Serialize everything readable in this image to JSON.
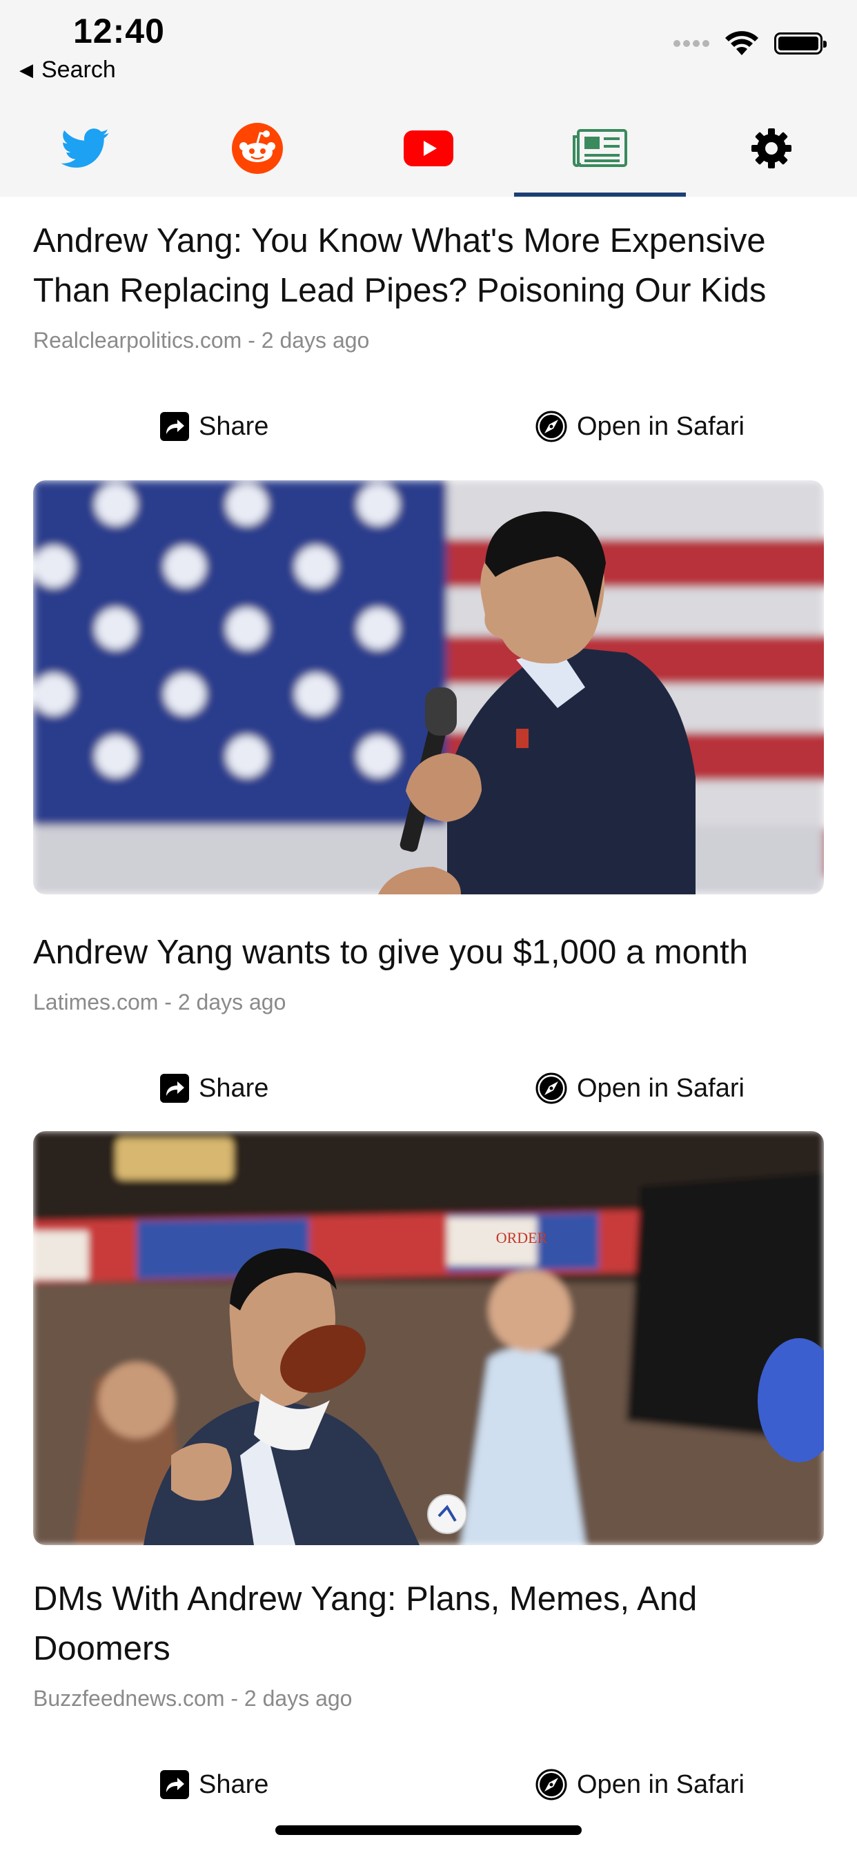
{
  "status_bar": {
    "time": "12:40",
    "back_label": "Search",
    "icons": [
      "cellular-signal-icon",
      "wifi-icon",
      "battery-icon"
    ]
  },
  "tabs": [
    {
      "name": "twitter",
      "icon": "twitter-bird-icon",
      "color": "#1da1f2",
      "active": false
    },
    {
      "name": "reddit",
      "icon": "reddit-alien-icon",
      "color": "#ff4500",
      "active": false
    },
    {
      "name": "youtube",
      "icon": "youtube-play-icon",
      "color": "#ff0000",
      "active": false
    },
    {
      "name": "news",
      "icon": "newspaper-icon",
      "color": "#3a8a5e",
      "active": true
    },
    {
      "name": "settings",
      "icon": "gear-icon",
      "color": "#000000",
      "active": false
    }
  ],
  "active_indicator_color": "#1c3f74",
  "articles": [
    {
      "title": "Andrew Yang: You Know What's More Expensive Than Replacing Lead Pipes? Poisoning Our Kids",
      "meta": "Realclearpolitics.com - 2 days ago",
      "share_label": "Share",
      "safari_label": "Open in Safari"
    },
    {
      "title": "Andrew Yang wants to give you $1,000 a month",
      "meta": "Latimes.com - 2 days ago",
      "share_label": "Share",
      "safari_label": "Open in Safari"
    },
    {
      "title": "DMs With Andrew Yang: Plans, Memes, And Doomers",
      "meta": "Buzzfeednews.com - 2 days ago",
      "share_label": "Share",
      "safari_label": "Open in Safari"
    }
  ]
}
